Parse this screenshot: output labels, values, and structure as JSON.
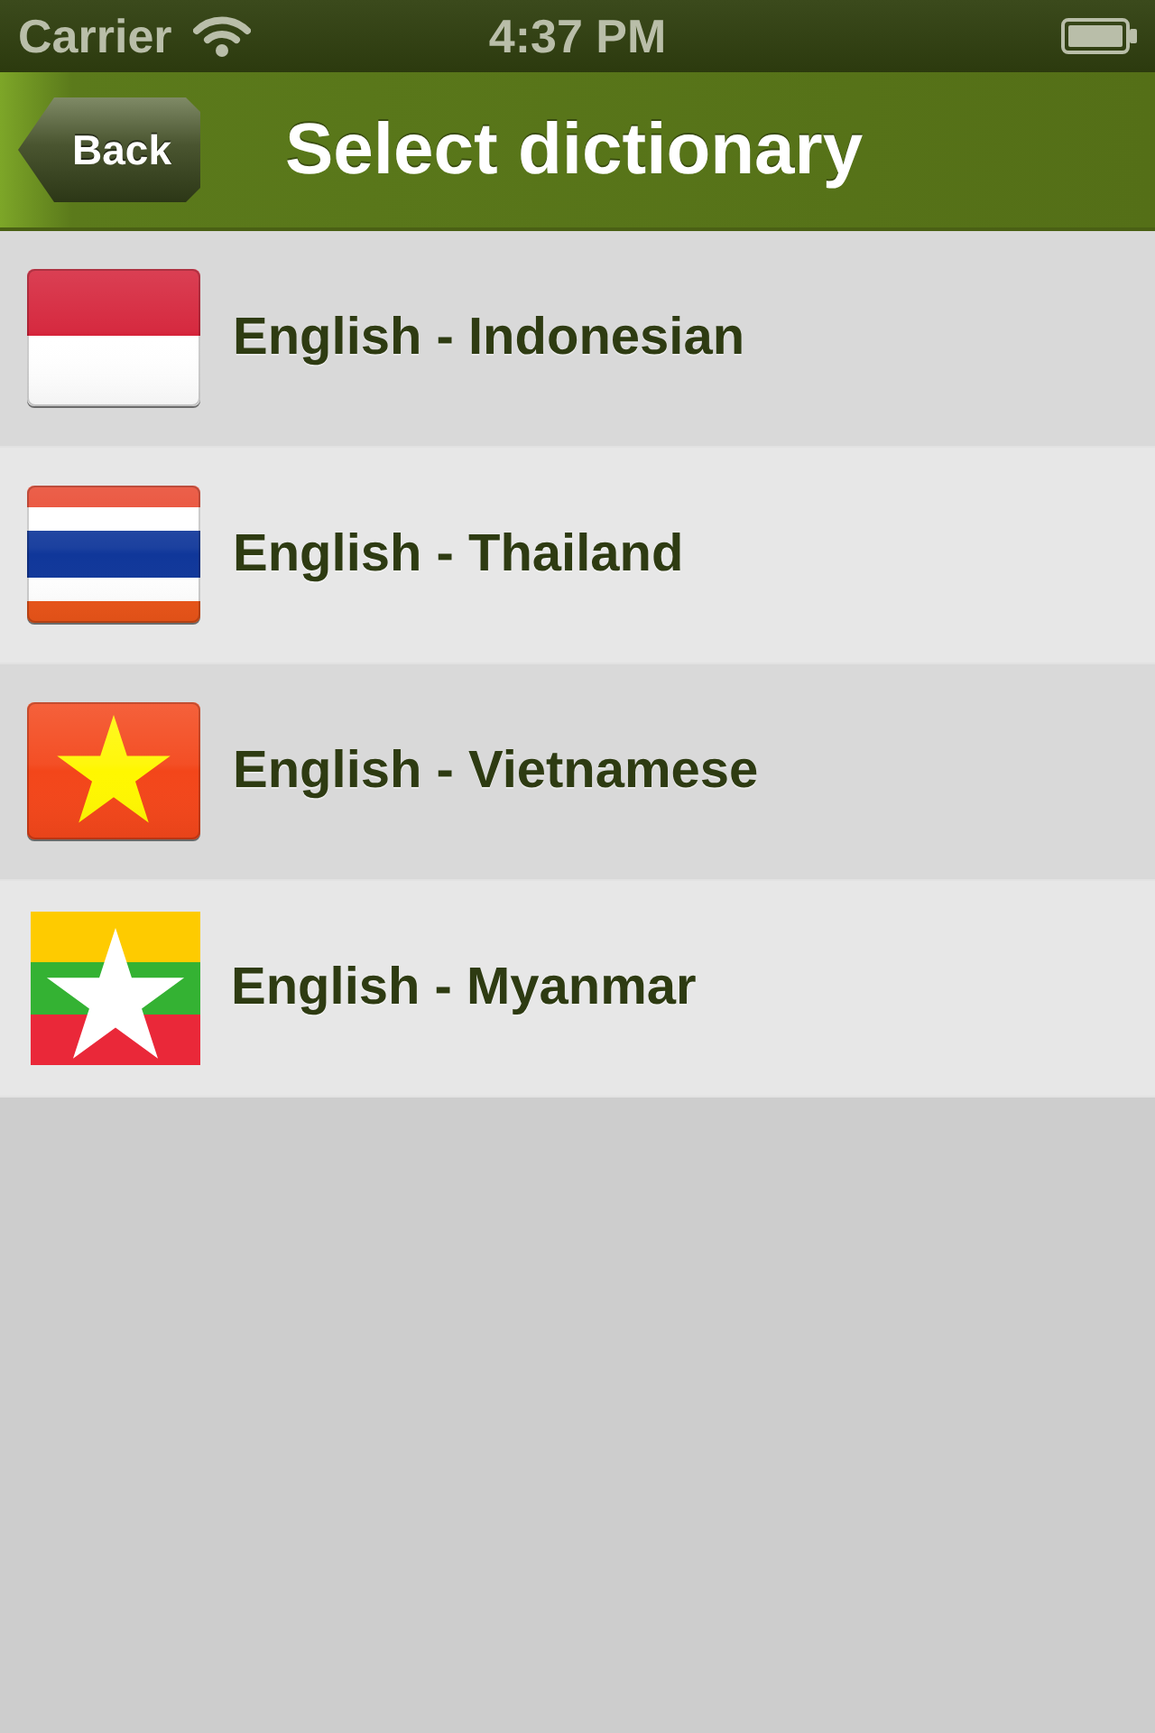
{
  "status_bar": {
    "carrier": "Carrier",
    "time": "4:37 PM"
  },
  "nav_bar": {
    "back_button": "Back",
    "title": "Select dictionary"
  },
  "dictionaries": [
    {
      "label": "English - Indonesian",
      "kind": "indonesia"
    },
    {
      "label": "English - Thailand",
      "kind": "thailand"
    },
    {
      "label": "English - Vietnamese",
      "kind": "vietnam"
    },
    {
      "label": "English - Myanmar",
      "kind": "myanmar"
    }
  ]
}
